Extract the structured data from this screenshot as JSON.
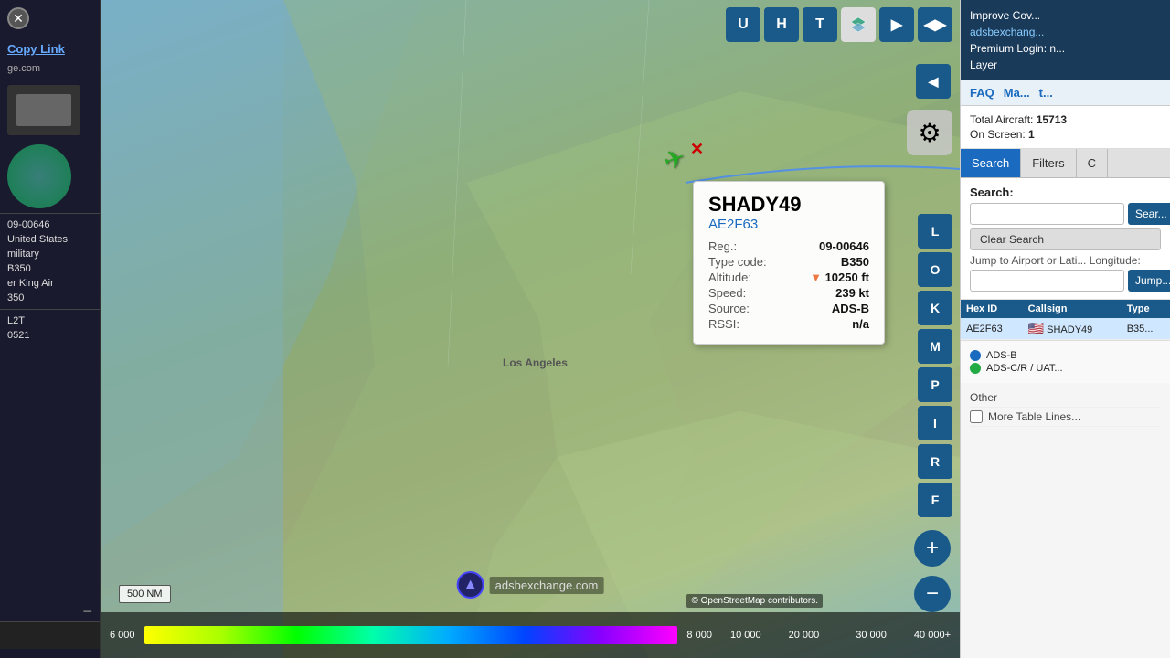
{
  "leftPanel": {
    "copyLink": "Copy Link",
    "domain": "ge.com",
    "registration": "09-00646",
    "country": "United States",
    "category": "military",
    "typeCode": "B350",
    "description": "er King Air",
    "model": "350",
    "airport": "L2T",
    "code": "0521"
  },
  "toolbar": {
    "btnU": "U",
    "btnH": "H",
    "btnT": "T",
    "btnForward": "▶",
    "btnCollapse": "◀▶",
    "btnBack": "◀"
  },
  "mapButtons": {
    "L": "L",
    "O": "O",
    "K": "K",
    "M": "M",
    "P": "P",
    "I": "I",
    "R": "R",
    "F": "F"
  },
  "aircraftPopup": {
    "callsign": "SHADY49",
    "hex": "AE2F63",
    "regLabel": "Reg.:",
    "regValue": "09-00646",
    "typeLabel": "Type code:",
    "typeValue": "B350",
    "altLabel": "Altitude:",
    "altArrow": "▼",
    "altValue": "10250 ft",
    "speedLabel": "Speed:",
    "speedValue": "239 kt",
    "sourceLabel": "Source:",
    "sourceValue": "ADS-B",
    "rssiLabel": "RSSI:",
    "rssiValue": "n/a"
  },
  "rightPanel": {
    "headerLine1": "Improve Cov...",
    "headerLink": "adsbexchang...",
    "premiumLine": "Premium Login: n...",
    "layerLine": "Layer",
    "faqLink": "FAQ",
    "mapLink": "Ma...",
    "extraLink": "t...",
    "totalLabel": "Total Aircraft:",
    "totalValue": "15713",
    "onScreenLabel": "On Screen:",
    "onScreenValue": "1",
    "tabs": [
      {
        "label": "Search",
        "active": true
      },
      {
        "label": "Filters",
        "active": false
      },
      {
        "label": "C",
        "active": false
      }
    ],
    "searchLabel": "Search:",
    "searchPlaceholder": "",
    "searchBtnLabel": "Sear...",
    "clearSearchLabel": "Clear Search",
    "jumpLabel": "Jump to Airport or Lati... Longitude:",
    "jumpPlaceholder": "",
    "jumpBtnLabel": "Jump...",
    "tableHeaders": [
      "Hex ID",
      "Callsign",
      "Type"
    ],
    "tableRow": {
      "hex": "AE2F63",
      "flag": "🇺🇸",
      "callsign": "SHADY49",
      "type": "B35..."
    },
    "sourceLegend": {
      "row1": "ADS-B",
      "row2": "ADS-C/R / UAT...",
      "row3": "Other"
    },
    "moreLabel": "More Table Lines...",
    "moreCheckbox": false
  },
  "mapElements": {
    "losAngeles": "Los Angeles",
    "scaleBar": "500 NM",
    "watermark": "adsbexchange.com",
    "attribution": "© OpenStreetMap contributors.",
    "colorBarLabels": [
      "6 000",
      "8 000",
      "10 000",
      "20 000",
      "30 000",
      "40 000+"
    ]
  },
  "icons": {
    "close": "✕",
    "gear": "⚙",
    "aircraft": "✈",
    "zoomPlus": "+",
    "zoomMinus": "−",
    "chevronLeft": "◀",
    "chevronRight": "▶",
    "chevronDown": "▼",
    "flag": "⚑"
  }
}
